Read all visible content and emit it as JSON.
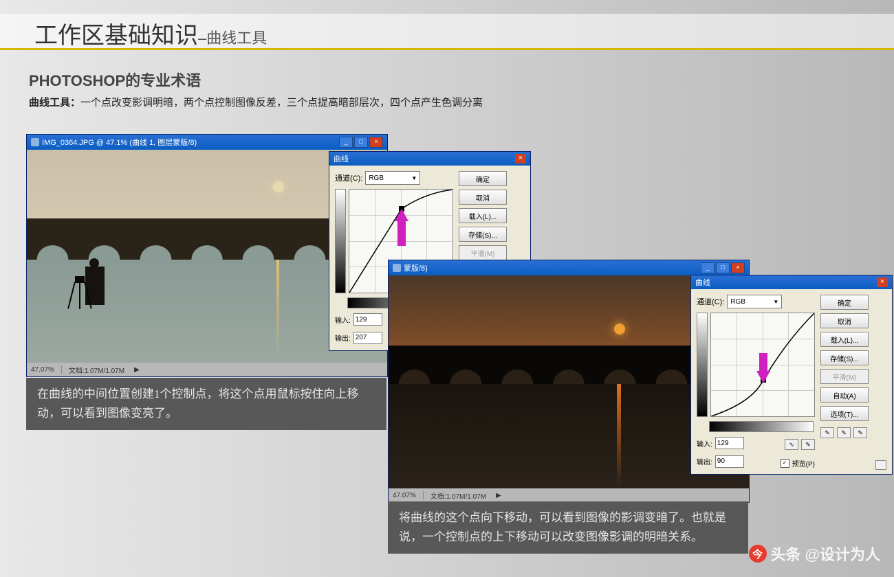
{
  "title": {
    "main": "工作区基础知识",
    "sub": "–曲线工具"
  },
  "heading": "PHOTOSHOP的专业术语",
  "subheading_label": "曲线工具：",
  "subheading_text": "一个点改变影调明暗，两个点控制图像反差，三个点提高暗部层次，四个点产生色调分离",
  "window1": {
    "title": "IMG_0364.JPG @ 47.1% (曲线 1, 图层蒙版/8)",
    "status_zoom": "47.07%",
    "status_doc": "文档:1.07M/1.07M"
  },
  "window2": {
    "title": "蒙版/8)",
    "status_zoom": "47.07%",
    "status_doc": "文档:1.07M/1.07M"
  },
  "curves": {
    "dlg_title": "曲线",
    "channel_label": "通道(C):",
    "channel_value": "RGB",
    "input_label": "输入:",
    "output_label": "输出:",
    "btns": {
      "ok": "确定",
      "cancel": "取消",
      "load": "载入(L)...",
      "save": "存储(S)...",
      "smooth": "平滑(M)",
      "auto": "自动(A)",
      "options": "选项(T)..."
    },
    "preview": "预览(P)"
  },
  "curve1": {
    "input": "129",
    "output": "207"
  },
  "curve2": {
    "input": "129",
    "output": "90"
  },
  "caption1": "在曲线的中间位置创建1个控制点，将这个点用鼠标按住向上移动，可以看到图像变亮了。",
  "caption2": "将曲线的这个点向下移动，可以看到图像的影调变暗了。也就是说，一个控制点的上下移动可以改变图像影调的明暗关系。",
  "watermark": {
    "brand": "头条",
    "author": "@设计为人"
  },
  "chart_data": [
    {
      "type": "line",
      "title": "曲线（提亮）",
      "xlabel": "输入",
      "ylabel": "输出",
      "xlim": [
        0,
        255
      ],
      "ylim": [
        0,
        255
      ],
      "points": [
        [
          0,
          0
        ],
        [
          129,
          207
        ],
        [
          255,
          255
        ]
      ],
      "control_point": {
        "x": 129,
        "y": 207
      }
    },
    {
      "type": "line",
      "title": "曲线（压暗）",
      "xlabel": "输入",
      "ylabel": "输出",
      "xlim": [
        0,
        255
      ],
      "ylim": [
        0,
        255
      ],
      "points": [
        [
          0,
          0
        ],
        [
          129,
          90
        ],
        [
          255,
          255
        ]
      ],
      "control_point": {
        "x": 129,
        "y": 90
      }
    }
  ]
}
